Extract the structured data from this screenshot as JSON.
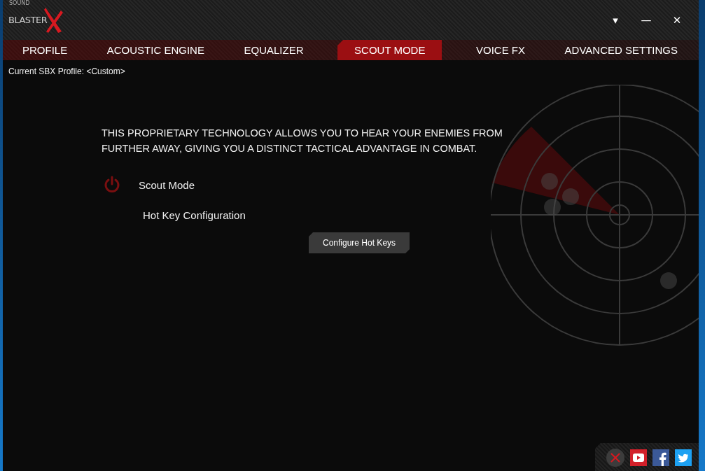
{
  "logo": {
    "small": "SOUND",
    "word": "BLASTER"
  },
  "window_controls": [
    "▾",
    "—",
    "✕"
  ],
  "tabs": [
    {
      "label": "PROFILE",
      "selected": false
    },
    {
      "label": "ACOUSTIC ENGINE",
      "selected": false
    },
    {
      "label": "EQUALIZER",
      "selected": false
    },
    {
      "label": "SCOUT MODE",
      "selected": true
    },
    {
      "label": "VOICE FX",
      "selected": false
    },
    {
      "label": "ADVANCED SETTINGS",
      "selected": false
    }
  ],
  "profile_line": "Current SBX Profile: <Custom>",
  "description": "THIS PROPRIETARY TECHNOLOGY ALLOWS YOU TO HEAR YOUR ENEMIES FROM FURTHER AWAY, GIVING YOU A DISTINCT TACTICAL ADVANTAGE IN COMBAT.",
  "scout_mode": {
    "label": "Scout Mode",
    "on": false
  },
  "hotkey_heading": "Hot Key Configuration",
  "configure_button": "Configure Hot Keys"
}
